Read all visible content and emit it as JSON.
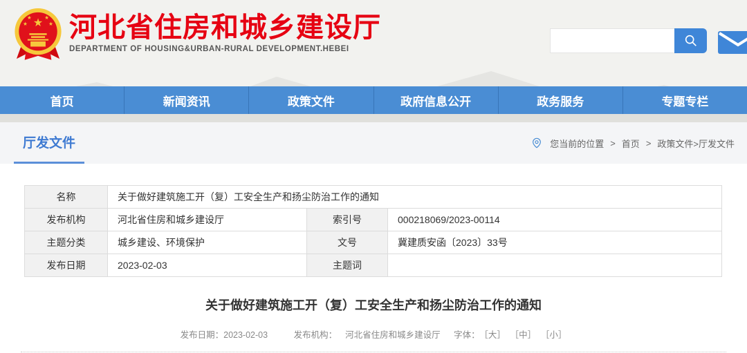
{
  "header": {
    "site_title": "河北省住房和城乡建设厅",
    "site_subtitle": "DEPARTMENT OF HOUSING&URBAN-RURAL DEVELOPMENT.HEBEI",
    "search": {
      "value": "",
      "placeholder": ""
    }
  },
  "nav": {
    "items": [
      {
        "label": "首页"
      },
      {
        "label": "新闻资讯"
      },
      {
        "label": "政策文件"
      },
      {
        "label": "政府信息公开"
      },
      {
        "label": "政务服务"
      },
      {
        "label": "专题专栏"
      }
    ]
  },
  "section": {
    "title": "厅发文件",
    "breadcrumb": {
      "location_label": "您当前的位置",
      "separator": ">",
      "crumbs": [
        "首页",
        "政策文件>厅发文件"
      ]
    }
  },
  "doc_table": {
    "name_row": {
      "label": "名称",
      "value": "关于做好建筑施工开（复）工安全生产和扬尘防治工作的通知"
    },
    "rows": [
      {
        "label1": "发布机构",
        "value1": "河北省住房和城乡建设厅",
        "label2": "索引号",
        "value2": "000218069/2023-00114"
      },
      {
        "label1": "主题分类",
        "value1": "城乡建设、环境保护",
        "label2": "文号",
        "value2": "冀建质安函〔2023〕33号"
      },
      {
        "label1": "发布日期",
        "value1": "2023-02-03",
        "label2": "主题词",
        "value2": ""
      }
    ]
  },
  "article": {
    "title": "关于做好建筑施工开（复）工安全生产和扬尘防治工作的通知",
    "meta": {
      "date_label": "发布日期：",
      "date": "2023-02-03",
      "publisher_label": "发布机构：",
      "publisher": "河北省住房和城乡建设厅",
      "font_label": "字体：",
      "font_large": "［大］",
      "font_medium": "［中］",
      "font_small": "［小］"
    }
  },
  "colors": {
    "nav_blue": "#4a8dd4",
    "accent_blue": "#3e7ad2",
    "brand_red": "#e60012",
    "label_cell_bg": "#f1f1f1"
  }
}
